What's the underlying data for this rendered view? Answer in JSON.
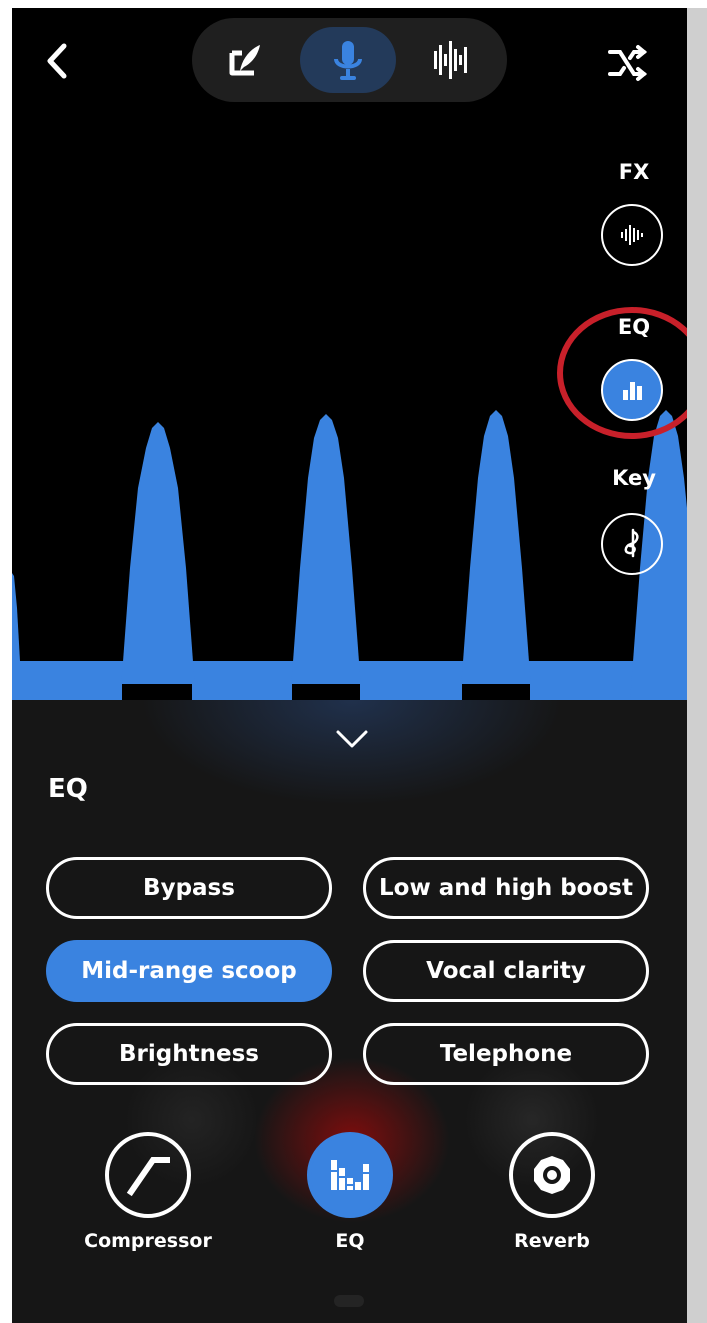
{
  "top_nav": {
    "back_icon": "chevron-left-icon",
    "modes": [
      {
        "name": "lyrics",
        "icon": "edit-quill-icon",
        "active": false
      },
      {
        "name": "record",
        "icon": "microphone-icon",
        "active": true
      },
      {
        "name": "beats",
        "icon": "waveform-icon",
        "active": false
      }
    ],
    "shuffle_icon": "shuffle-icon"
  },
  "side_tools": {
    "fx_label": "FX",
    "eq_label": "EQ",
    "key_label": "Key",
    "fx_icon": "waveform-icon",
    "eq_icon": "bar-chart-icon",
    "key_icon": "music-note-icon"
  },
  "panel": {
    "title": "EQ",
    "presets": [
      {
        "label": "Bypass",
        "active": false
      },
      {
        "label": "Low and high boost",
        "active": false
      },
      {
        "label": "Mid-range scoop",
        "active": true
      },
      {
        "label": "Vocal clarity",
        "active": false
      },
      {
        "label": "Brightness",
        "active": false
      },
      {
        "label": "Telephone",
        "active": false
      }
    ],
    "tools": [
      {
        "label": "Compressor",
        "icon": "compressor-icon",
        "active": false
      },
      {
        "label": "EQ",
        "icon": "eq-bars-icon",
        "active": true
      },
      {
        "label": "Reverb",
        "icon": "reverb-icon",
        "active": false
      }
    ]
  },
  "colors": {
    "accent": "#3a83e0",
    "highlight_ring": "#c8202a",
    "background": "#000000",
    "panel": "#161616"
  }
}
